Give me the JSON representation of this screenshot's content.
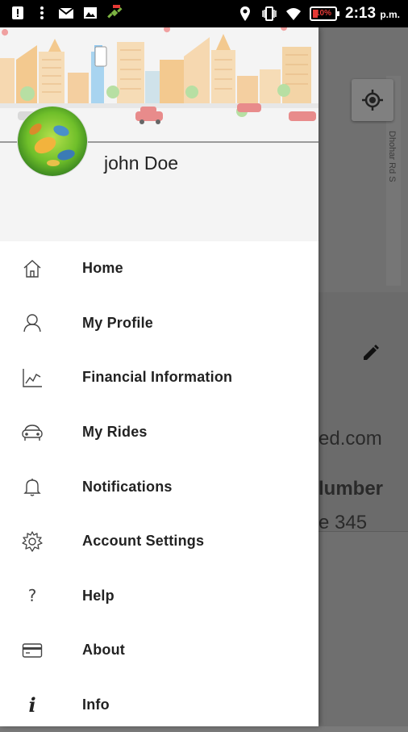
{
  "status_bar": {
    "time": "2:13",
    "ampm": "p.m.",
    "battery": "10%"
  },
  "background": {
    "road_label": "Dhohar Rd S",
    "partial_email": "ed.com",
    "partial_heading": "lumber",
    "partial_number": "e 345"
  },
  "drawer": {
    "user_name": "john Doe",
    "menu": [
      {
        "label": "Home",
        "icon": "home-icon"
      },
      {
        "label": "My Profile",
        "icon": "profile-icon"
      },
      {
        "label": "Financial Information",
        "icon": "chart-icon"
      },
      {
        "label": "My Rides",
        "icon": "car-icon"
      },
      {
        "label": "Notifications",
        "icon": "bell-icon"
      },
      {
        "label": "Account Settings",
        "icon": "gear-icon"
      },
      {
        "label": "Help",
        "icon": "help-icon"
      },
      {
        "label": "About",
        "icon": "card-icon"
      },
      {
        "label": "Info",
        "icon": "info-icon"
      }
    ]
  },
  "colors": {
    "accent": "#f2c94c",
    "overlay": "#6f6f6f",
    "header_bg": "#f4f4f4"
  }
}
